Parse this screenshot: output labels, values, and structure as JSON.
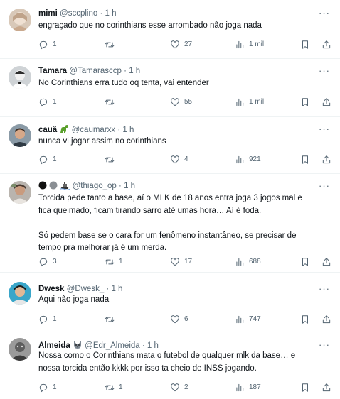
{
  "tweets": [
    {
      "name": "mimi",
      "handle": "@sccplino",
      "dot": "·",
      "time": "1 h",
      "lines": [
        "engraçado que no corinthians esse arrombado não joga nada"
      ],
      "replies": "1",
      "retweets": "",
      "likes": "27",
      "views": "1 mil"
    },
    {
      "name": "Tamara",
      "handle": "@Tamarasccp",
      "dot": "·",
      "time": "1 h",
      "lines": [
        "No Corinthians erra tudo oq tenta, vai entender"
      ],
      "replies": "1",
      "retweets": "",
      "likes": "55",
      "views": "1 mil"
    },
    {
      "name": "cauã",
      "handle": "@caumarxx",
      "dot": "·",
      "time": "1 h",
      "lines": [
        "nunca vi jogar assim no corinthians"
      ],
      "replies": "1",
      "retweets": "",
      "likes": "4",
      "views": "921"
    },
    {
      "name": "",
      "handle": "@thiago_op",
      "dot": "·",
      "time": "1 h",
      "lines": [
        "Torcida pede tanto a base, aí o MLK de 18 anos entra joga 3 jogos mal e",
        "fica queimado, ficam tirando sarro até umas hora… Aí é foda.",
        "",
        "Só pedem base se o cara for um fenômeno instantâneo, se precisar de",
        "tempo pra melhorar já é um merda."
      ],
      "replies": "3",
      "retweets": "1",
      "likes": "17",
      "views": "688"
    },
    {
      "name": "Dwesk",
      "handle": "@Dwesk_",
      "dot": "·",
      "time": "1 h",
      "lines": [
        "Aqui não joga nada"
      ],
      "replies": "1",
      "retweets": "",
      "likes": "6",
      "views": "747"
    },
    {
      "name": "Almeida",
      "handle": "@Edr_Almeida",
      "dot": "·",
      "time": "1 h",
      "lines": [
        "Nossa como o Corinthians mata o futebol de qualquer mlk da base… e",
        "nossa torcida então kkkk por isso ta cheio de INSS jogando."
      ],
      "replies": "1",
      "retweets": "1",
      "likes": "2",
      "views": "187"
    }
  ],
  "icons": {
    "more": "more-dots-icon",
    "reply": "reply-icon",
    "retweet": "retweet-icon",
    "like": "heart-icon",
    "views": "views-icon",
    "bookmark": "bookmark-icon",
    "share": "share-icon"
  },
  "colors": {
    "text": "#0f1419",
    "muted": "#536471",
    "divider": "#eff3f4"
  }
}
